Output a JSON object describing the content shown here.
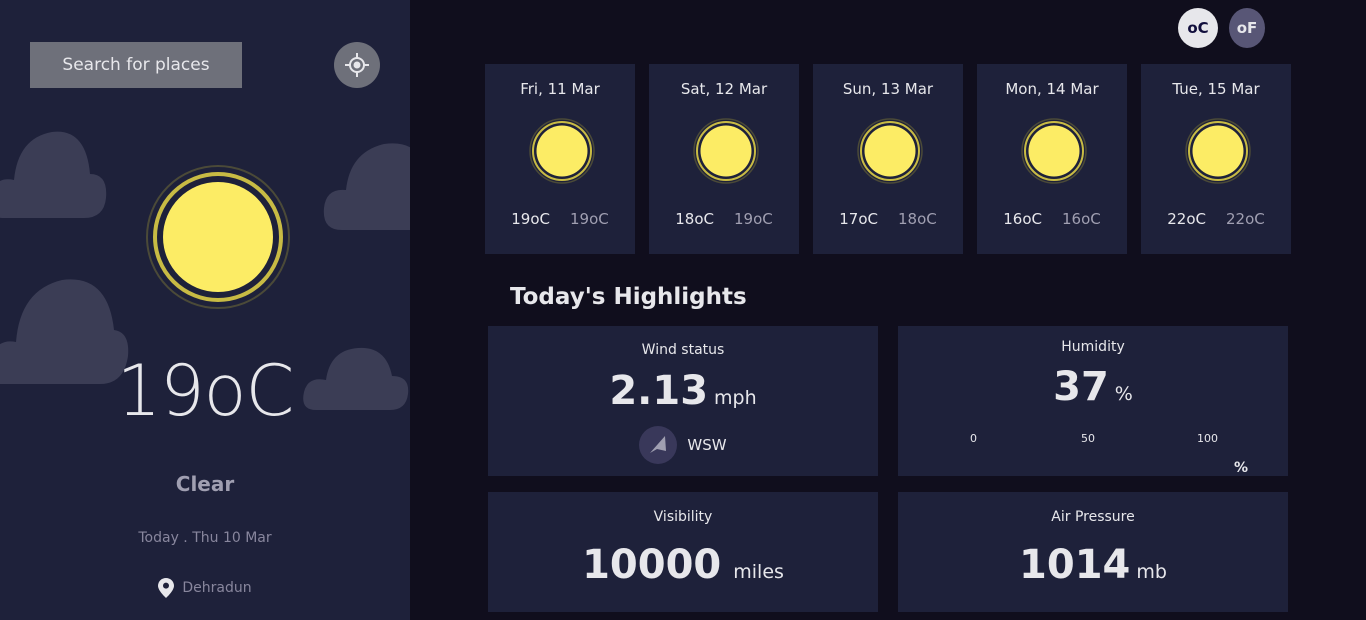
{
  "sidebar": {
    "search_label": "Search for places",
    "locate_icon": "crosshair-icon",
    "weather_icon": "sun-icon",
    "temp_value": "19",
    "temp_unit": "oC",
    "condition": "Clear",
    "date": "Today . Thu 10 Mar",
    "location_icon": "map-pin-icon",
    "location": "Dehradun"
  },
  "units": {
    "celsius": "oC",
    "fahrenheit": "oF",
    "selected": "celsius"
  },
  "forecast": [
    {
      "date": "Fri, 11 Mar",
      "max": "19oC",
      "min": "19oC"
    },
    {
      "date": "Sat, 12 Mar",
      "max": "18oC",
      "min": "19oC"
    },
    {
      "date": "Sun, 13 Mar",
      "max": "17oC",
      "min": "18oC"
    },
    {
      "date": "Mon, 14 Mar",
      "max": "16oC",
      "min": "16oC"
    },
    {
      "date": "Tue, 15 Mar",
      "max": "22oC",
      "min": "22oC"
    }
  ],
  "highlights": {
    "title": "Today's Highlights",
    "wind": {
      "label": "Wind status",
      "value": "2.13",
      "unit": "mph",
      "direction": "WSW",
      "icon": "navigation-arrow-icon"
    },
    "humidity": {
      "label": "Humidity",
      "value": "37",
      "unit": "%",
      "scale": [
        "0",
        "50",
        "100"
      ],
      "scale_unit": "%"
    },
    "visibility": {
      "label": "Visibility",
      "value": "10000",
      "unit": "miles"
    },
    "pressure": {
      "label": "Air Pressure",
      "value": "1014",
      "unit": "mb"
    }
  },
  "colors": {
    "background": "#100e1d",
    "panel": "#1e213a",
    "sun": "#fcec65",
    "text": "#e7e7eb",
    "muted": "#a09fb1"
  }
}
